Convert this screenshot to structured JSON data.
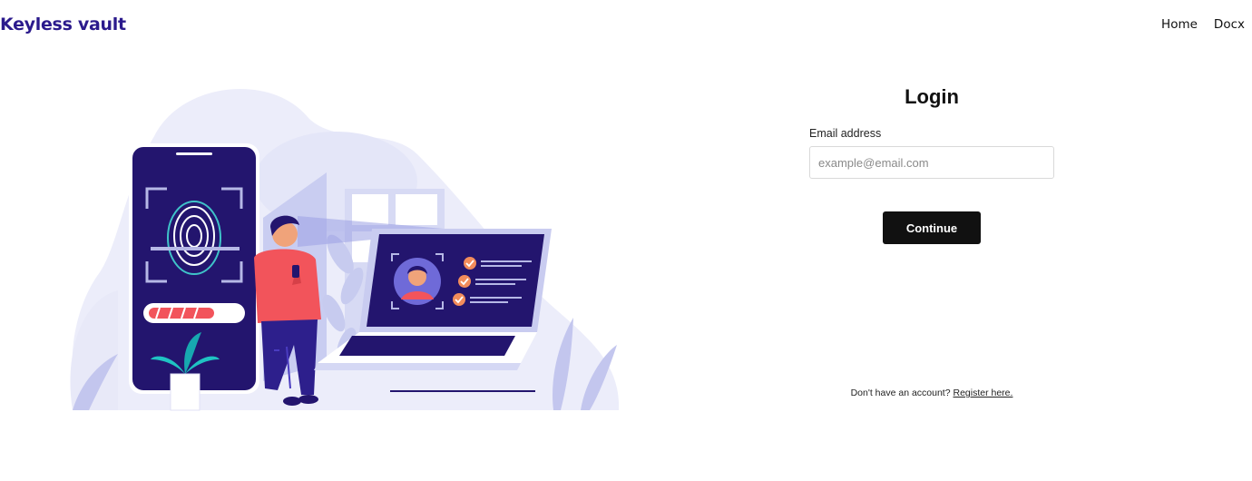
{
  "header": {
    "brand": "Keyless vault",
    "nav": [
      {
        "label": "Home"
      },
      {
        "label": "Docx"
      }
    ]
  },
  "login": {
    "title": "Login",
    "email_label": "Email address",
    "email_placeholder": "example@email.com",
    "email_value": "",
    "continue_label": "Continue"
  },
  "footer": {
    "prompt": "Don't have an account?",
    "register_link": "Register here."
  },
  "colors": {
    "brand": "#2b1a8c",
    "button": "#111111",
    "illustration_navy": "#23156e",
    "illustration_accent": "#f2545b"
  },
  "illustration": {
    "icons": [
      "fingerprint-icon",
      "progress-bar",
      "person-figure",
      "laptop-icon",
      "face-scan-icon",
      "check-icon",
      "plant-icon"
    ]
  }
}
